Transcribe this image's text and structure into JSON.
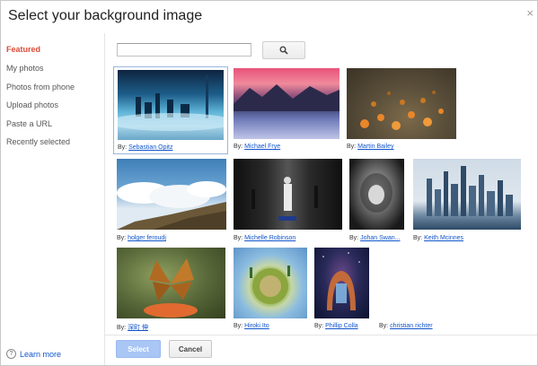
{
  "dialog": {
    "title": "Select your background image",
    "close_label": "×"
  },
  "sidebar": {
    "items": [
      {
        "label": "Featured",
        "active": true
      },
      {
        "label": "My photos"
      },
      {
        "label": "Photos from phone"
      },
      {
        "label": "Upload photos"
      },
      {
        "label": "Paste a URL"
      },
      {
        "label": "Recently selected"
      }
    ],
    "learn_more": "Learn more",
    "help_icon": "?"
  },
  "search": {
    "placeholder": "",
    "button_icon": "search-icon"
  },
  "thumbnails": [
    {
      "by": "By:",
      "author": "Sebastian Opitz",
      "image": "city-skyline-fog",
      "selected": true
    },
    {
      "by": "By:",
      "author": "Michael Frye",
      "image": "mountain-lake-sunset"
    },
    {
      "by": "By:",
      "author": "Martin Bailey",
      "image": "orange-flowers-field"
    },
    {
      "by": "By:",
      "author": "holger feroudj",
      "image": "clouds-hillside"
    },
    {
      "by": "By:",
      "author": "Michelle Robinson",
      "image": "street-performer"
    },
    {
      "by": "By:",
      "author": "Johan Swan...",
      "image": "lion-black-white"
    },
    {
      "by": "By:",
      "author": "Keith Mcinnes",
      "image": "dubai-skyline"
    },
    {
      "by": "By:",
      "author": "深町 伸",
      "image": "butterfly-flower"
    },
    {
      "by": "By:",
      "author": "Hiroki Ito",
      "image": "tiny-planet"
    },
    {
      "by": "By:",
      "author": "Phillip Colla",
      "image": "arch-starry-night"
    },
    {
      "by": "By:",
      "author": "christian richter",
      "image": "none"
    }
  ],
  "footer": {
    "select_label": "Select",
    "cancel_label": "Cancel"
  },
  "colors": {
    "accent": "#dd4b39",
    "link": "#1155cc",
    "select_button": "#a9c6f5"
  }
}
